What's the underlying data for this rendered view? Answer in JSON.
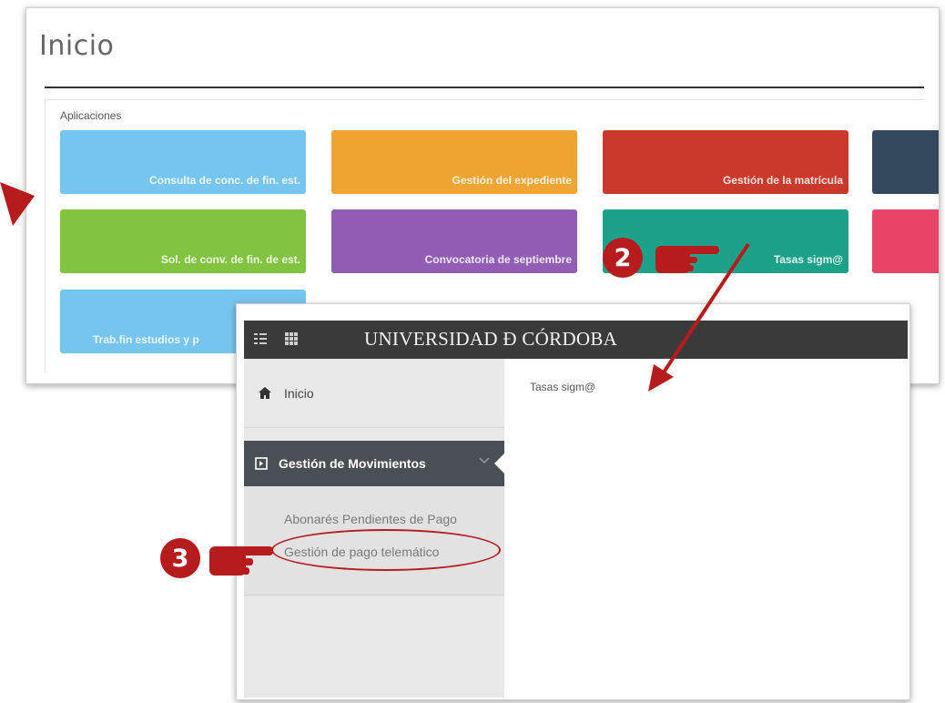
{
  "back_window": {
    "title": "Inicio",
    "section_label": "Aplicaciones",
    "tiles": [
      {
        "label": "Consulta de conc. de fin. est.",
        "color": "#76c5ef"
      },
      {
        "label": "Gestión del expediente",
        "color": "#f0a533"
      },
      {
        "label": "Gestión de la matrícula",
        "color": "#c9392c"
      },
      {
        "label": "",
        "color": "#34495e"
      },
      {
        "label": "Sol. de conv. de fin. de est.",
        "color": "#82c341"
      },
      {
        "label": "Convocatoria de septiembre",
        "color": "#925db5"
      },
      {
        "label": "Tasas sigm@",
        "color": "#1ea18a"
      },
      {
        "label": "",
        "color": "#e84466"
      },
      {
        "label": "Trab.fin estudios y p",
        "color": "#76c5ef"
      }
    ]
  },
  "front_window": {
    "brand": "UNIVERSIDAD Ð CÓRDOBA",
    "nav": {
      "home_label": "Inicio",
      "group_label": "Gestión de Movimientos",
      "sub_items": [
        "Abonarés Pendientes de Pago",
        "Gestión de pago telemático"
      ]
    },
    "breadcrumb": "Tasas sigm@"
  },
  "annotations": {
    "step_2": "2",
    "step_3": "3",
    "accent_color": "#b71c1c"
  }
}
